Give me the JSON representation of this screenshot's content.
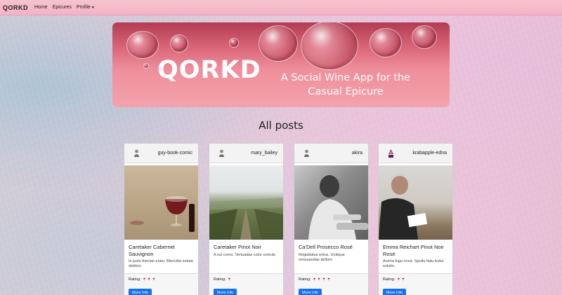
{
  "nav": {
    "brand": "QORKD",
    "links": [
      "Home",
      "Epicures",
      "Profile"
    ]
  },
  "hero": {
    "title": "QORKD",
    "tagline": "A Social Wine App for the Casual Epicure"
  },
  "section_title": "All posts",
  "posts": [
    {
      "username": "guy-book-comic",
      "avatar_icon": "person-icon",
      "title": "Caretaker Cabernet Sauvignon",
      "description": "In justo theciae eratu. Blencitta sotuta debitos",
      "rating_label": "Rating:",
      "rating": "🍷🍷🍷",
      "button_label": "More Info"
    },
    {
      "username": "mary_bailey",
      "avatar_icon": "person-icon",
      "title": "Caretaker Pinot Noir",
      "description": "A sut cornu. Vertuadas cotur ocleuts",
      "rating_label": "Rating:",
      "rating": "🍷",
      "button_label": "More Info"
    },
    {
      "username": "akira",
      "avatar_icon": "person-icon",
      "title": "Ca'Dell Prosecco Rosé",
      "description": "Regiatiatus entus. Unitique nessuandae dellum.",
      "rating_label": "Rating:",
      "rating": "🍷🍷🍷🍷",
      "button_label": "More Info"
    },
    {
      "username": "krabapple-edna",
      "avatar_icon": "person-icon",
      "title": "Emma Reichart Pinot Noir Rosé",
      "description": "Averta fugu crout. Spoltu tlatu truba solutis.",
      "rating_label": "Rating:",
      "rating": "🍷🍷",
      "button_label": "More Info"
    }
  ]
}
